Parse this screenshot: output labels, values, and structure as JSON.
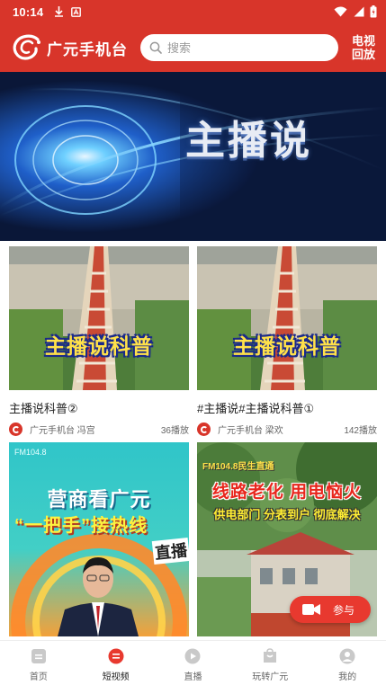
{
  "status_bar": {
    "time": "10:14"
  },
  "header": {
    "logo_text": "广元手机台",
    "search_placeholder": "搜索",
    "tv_replay_line1": "电视",
    "tv_replay_line2": "回放"
  },
  "banner": {
    "title": "主播说"
  },
  "videos": [
    {
      "thumb_caption": "主播说科普",
      "title": "主播说科普②",
      "author": "广元手机台 冯宫",
      "plays": "36播放"
    },
    {
      "thumb_caption": "主播说科普",
      "title": "#主播说#主播说科普①",
      "author": "广元手机台 梁欢",
      "plays": "142播放"
    }
  ],
  "lower_cards": [
    {
      "label": "FM104.8",
      "title_line1": "营商看广元",
      "title_line2": "“一把手”接热线",
      "live_tag": "直播"
    },
    {
      "top_text": "FM104.8民生直通",
      "title": "线路老化 用电恼火",
      "subtitle": "供电部门 分表到户 彻底解决"
    }
  ],
  "join_button": {
    "label": "参与"
  },
  "bottom_nav": [
    {
      "label": "首页",
      "icon": "home-icon",
      "active": false
    },
    {
      "label": "短视频",
      "icon": "short-video-icon",
      "active": true
    },
    {
      "label": "直播",
      "icon": "live-icon",
      "active": false
    },
    {
      "label": "玩转广元",
      "icon": "explore-icon",
      "active": false
    },
    {
      "label": "我的",
      "icon": "profile-icon",
      "active": false
    }
  ],
  "colors": {
    "brand_red": "#d8352a",
    "join_red": "#e8392f",
    "banner_navy": "#0a1738"
  }
}
